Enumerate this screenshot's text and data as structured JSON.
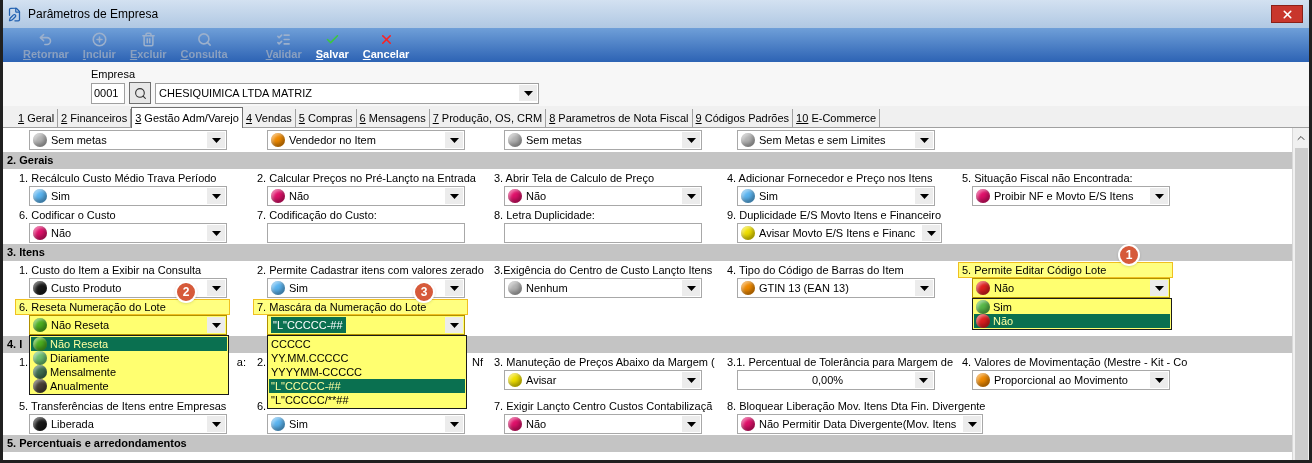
{
  "window": {
    "title": "Parâmetros de Empresa"
  },
  "toolbar": [
    {
      "label": "Retornar",
      "disabled": true
    },
    {
      "label": "Incluir",
      "disabled": true
    },
    {
      "label": "Excluir",
      "disabled": true
    },
    {
      "label": "Consulta",
      "disabled": true
    },
    {
      "label": "Validar",
      "disabled": true
    },
    {
      "label": "Salvar",
      "disabled": false
    },
    {
      "label": "Cancelar",
      "disabled": false
    }
  ],
  "empresa": {
    "label": "Empresa",
    "code": "0001",
    "name": "CHESIQUIMICA LTDA MATRIZ"
  },
  "tabs": [
    {
      "number": "1",
      "label": "Geral",
      "selected": false
    },
    {
      "number": "2",
      "label": "Financeiros",
      "selected": false
    },
    {
      "number": "3",
      "label": "Gestão Adm/Varejo",
      "selected": true
    },
    {
      "number": "4",
      "label": "Vendas",
      "selected": false
    },
    {
      "number": "5",
      "label": "Compras",
      "selected": false
    },
    {
      "number": "6",
      "label": "Mensagens",
      "selected": false
    },
    {
      "number": "7",
      "label": "Produção, OS, CRM",
      "selected": false
    },
    {
      "number": "8",
      "label": "Parametros de Nota Fiscal",
      "selected": false
    },
    {
      "number": "9",
      "label": "Códigos Padrões",
      "selected": false
    },
    {
      "number": "10",
      "label": "E-Commerce",
      "selected": false
    }
  ],
  "top_row": [
    {
      "value": "Sem metas",
      "color": "#b4b4b4"
    },
    {
      "value": "Vendedor no Item",
      "color": "#f08a00"
    },
    {
      "value": "Sem metas",
      "color": "#b4b4b4"
    },
    {
      "value": "Sem Metas e sem Limites",
      "color": "#b4b4b4"
    }
  ],
  "sections": [
    {
      "title": "2. Gerais",
      "rows": [
        [
          {
            "label": "1. Recálculo Custo Médio Trava Período",
            "highlighted": false,
            "control": {
              "kind": "select",
              "value": "Sim",
              "color": "#5ab4f0"
            }
          },
          {
            "label": "2. Calcular Preços no Pré-Lançto na Entrada",
            "highlighted": false,
            "control": {
              "kind": "select",
              "value": "Não",
              "color": "#e0106a"
            }
          },
          {
            "label": "3. Abrir Tela de Calculo de Preço",
            "highlighted": false,
            "control": {
              "kind": "select",
              "value": "Não",
              "color": "#e0106a"
            }
          },
          {
            "label": "4. Adicionar Fornecedor e Preço nos Itens",
            "highlighted": false,
            "control": {
              "kind": "select",
              "value": "Sim",
              "color": "#5ab4f0"
            }
          },
          {
            "label": "5. Situação Fiscal não Encontrada:",
            "highlighted": false,
            "control": {
              "kind": "select",
              "value": "Proibir NF e Movto E/S Itens",
              "color": "#e0106a"
            }
          }
        ],
        [
          {
            "label": "6. Codificar o Custo",
            "highlighted": false,
            "control": {
              "kind": "select",
              "value": "Não",
              "color": "#e0106a"
            }
          },
          {
            "label": "7. Codificação do Custo:",
            "highlighted": false,
            "control": {
              "kind": "text"
            }
          },
          {
            "label": "8. Letra Duplicidade:",
            "highlighted": false,
            "control": {
              "kind": "text"
            }
          },
          {
            "label": "9. Duplicidade E/S Movto Itens e Financeiro",
            "highlighted": false,
            "control": {
              "kind": "select",
              "value": "Avisar Movto E/S Itens e Financ",
              "color": "#f0e000"
            }
          }
        ]
      ]
    },
    {
      "title": "3. Itens",
      "rows": [
        [
          {
            "label": "1. Custo do Item a Exibir na Consulta",
            "highlighted": false,
            "control": {
              "kind": "select",
              "value": "Custo Produto",
              "color": "#1a1a1a"
            }
          },
          {
            "label": "2. Permite Cadastrar itens com valores zerado",
            "highlighted": false,
            "control": {
              "kind": "select",
              "value": "Sim",
              "color": "#5ab4f0"
            }
          },
          {
            "label": "3.Exigência do Centro de Custo Lançto Itens",
            "highlighted": false,
            "control": {
              "kind": "select",
              "value": "Nenhum",
              "color": "#b4b4b4"
            }
          },
          {
            "label": "4. Tipo do Código de Barras do Item",
            "highlighted": false,
            "control": {
              "kind": "select",
              "value": "GTIN 13 (EAN 13)",
              "color": "#f08a00"
            }
          },
          {
            "label": "5. Permite Editar Código Lote",
            "highlighted": true,
            "badge": "1",
            "control": {
              "kind": "select",
              "value": "Não",
              "color": "#e02020",
              "open": true,
              "options": [
                {
                  "label": "Sim",
                  "color": "#58b848",
                  "selected": false
                },
                {
                  "label": "Não",
                  "color": "#e02020",
                  "selected": true
                }
              ]
            }
          }
        ],
        [
          {
            "label": "6. Reseta Numeração do Lote",
            "highlighted": true,
            "badge": "2",
            "control": {
              "kind": "select",
              "value": "Não Reseta",
              "color": "#4caf20",
              "open": true,
              "options": [
                {
                  "label": "Não Reseta",
                  "color": "#4caf20",
                  "selected": true
                },
                {
                  "label": "Diariamente",
                  "color": "#6cc070",
                  "selected": false
                },
                {
                  "label": "Mensalmente",
                  "color": "#3f6f50",
                  "selected": false
                },
                {
                  "label": "Anualmente",
                  "color": "#4a4036",
                  "selected": false
                }
              ]
            }
          },
          {
            "label": "7. Mascára da Numeração do Lote",
            "highlighted": true,
            "badge": "3",
            "control": {
              "kind": "select",
              "value": "\"L\"CCCCC-##",
              "text_selected": true,
              "open": true,
              "options": [
                {
                  "label": "CCCCC",
                  "selected": false
                },
                {
                  "label": "YY.MM.CCCCC",
                  "selected": false
                },
                {
                  "label": "YYYYMM-CCCCC",
                  "selected": false
                },
                {
                  "label": "\"L\"CCCCC-##",
                  "selected": true
                },
                {
                  "label": "\"L\"CCCCC/**##",
                  "selected": false
                }
              ]
            }
          }
        ]
      ]
    },
    {
      "title": "4. I",
      "rows": [
        [
          {
            "label": "1.",
            "label_end": "a:",
            "highlighted": false
          },
          {
            "label": "2.",
            "label_end": "Nf",
            "highlighted": false
          },
          {
            "label": "3. Manuteção de Preços Abaixo  da Margem (",
            "highlighted": false,
            "control": {
              "kind": "select",
              "value": "Avisar",
              "color": "#f0e000"
            }
          },
          {
            "label": "3.1. Percentual de Tolerância para Margem de",
            "highlighted": false,
            "control": {
              "kind": "number",
              "value": "0,00%"
            }
          },
          {
            "label": "4. Valores de Movimentação (Mestre - Kit - Co",
            "highlighted": false,
            "control": {
              "kind": "select",
              "value": "Proporcional ao Movimento",
              "color": "#f08a00"
            }
          }
        ],
        [
          {
            "label": "5. Transferências  de Itens entre Empresas",
            "highlighted": false,
            "control": {
              "kind": "select",
              "value": "Liberada",
              "color": "#1a1a1a"
            }
          },
          {
            "label": "6.",
            "highlighted": false,
            "control": {
              "kind": "select",
              "value": "Sim",
              "color": "#5ab4f0"
            }
          },
          {
            "label": "7. Exigir Lançto Centro Custos Contabilizaçã",
            "highlighted": false,
            "control": {
              "kind": "select",
              "value": "Não",
              "color": "#e0106a"
            }
          },
          {
            "label": "8. Bloquear Liberação Mov. Itens Dta Fin. Divergente",
            "highlighted": false,
            "control": {
              "kind": "select",
              "value": "Não Permitir Data Divergente(Mov. Itens",
              "color": "#e0106a"
            }
          }
        ]
      ]
    },
    {
      "title": "5. Percentuais e arredondamentos"
    }
  ]
}
